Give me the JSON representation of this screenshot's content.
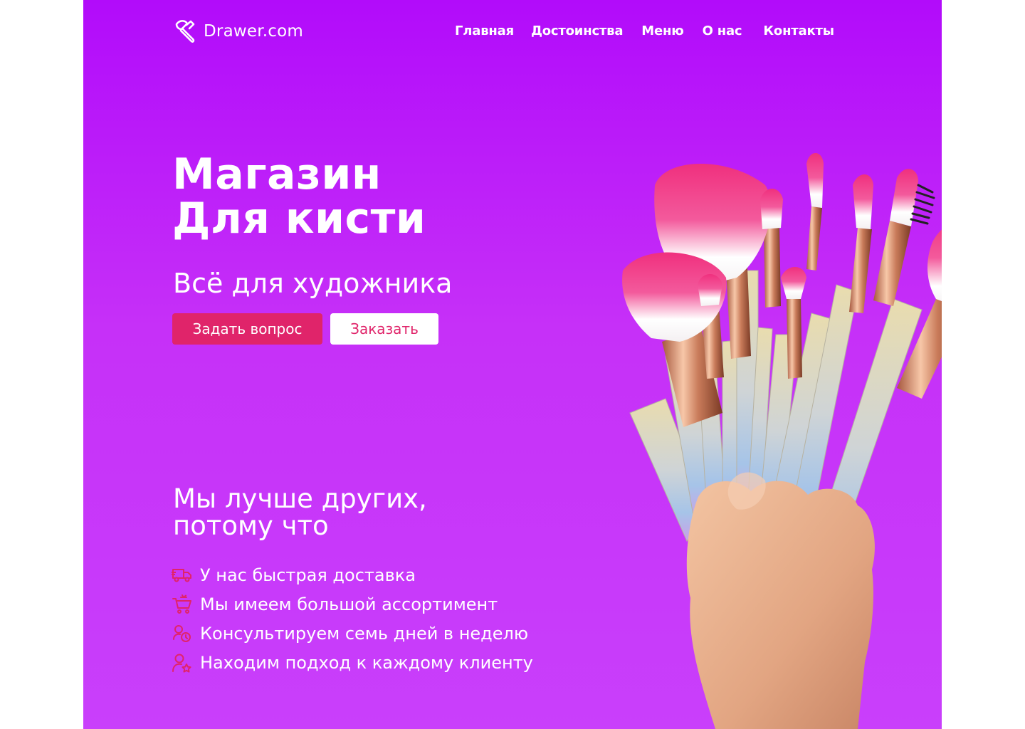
{
  "brand": {
    "name": "Drawer.com",
    "logo_icon": "brush-logo-icon"
  },
  "nav": {
    "items": [
      {
        "label": "Главная"
      },
      {
        "label": "Достоинства"
      },
      {
        "label": "Меню"
      },
      {
        "label": "О нас"
      },
      {
        "label": "Контакты"
      }
    ]
  },
  "hero": {
    "title_line1": "Магазин",
    "title_line2": "Для кисти",
    "subtitle": "Всё для художника",
    "ask_button": "Задать вопрос",
    "order_button": "Заказать"
  },
  "why": {
    "title_line1": "Мы лучше других,",
    "title_line2": "потому что",
    "features": [
      {
        "icon": "delivery-truck-icon",
        "text": "У нас быстрая доставка"
      },
      {
        "icon": "shopping-cart-icon",
        "text": "Мы имеем большой ассортимент"
      },
      {
        "icon": "consultant-clock-icon",
        "text": "Консультируем семь дней в неделю"
      },
      {
        "icon": "user-star-icon",
        "text": "Находим подход к каждому клиенту"
      }
    ]
  },
  "colors": {
    "background_top": "#b20bfa",
    "background_bottom": "#c93ffb",
    "accent": "#e0246a",
    "text": "#ffffff"
  }
}
